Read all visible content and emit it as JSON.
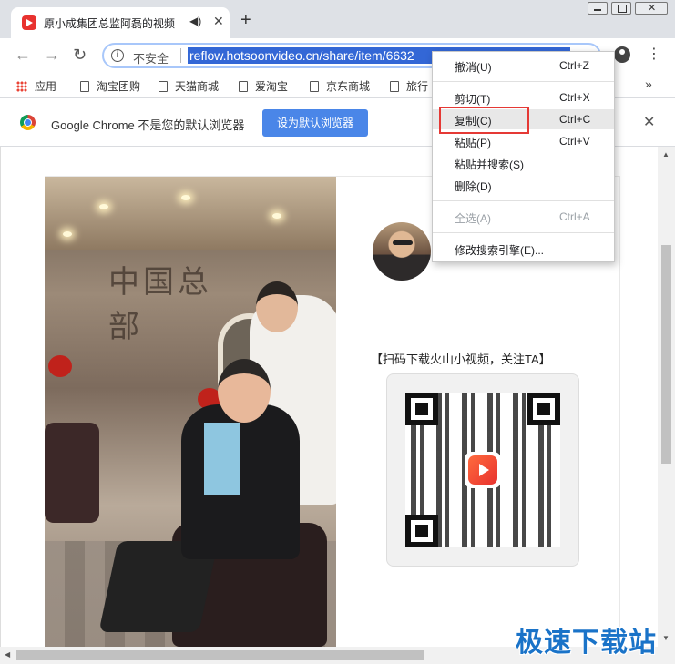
{
  "tab": {
    "title": "原小成集团总监阿磊的视频",
    "audio_icon": "speaker-icon",
    "close_glyph": "✕",
    "new_tab_glyph": "+"
  },
  "toolbar": {
    "security_label": "不安全",
    "url": "reflow.hotsoonvideo.cn/share/item/6632",
    "back_glyph": "←",
    "forward_glyph": "→",
    "reload_glyph": "↻",
    "menu_glyph": "⋮"
  },
  "bookmarks": {
    "items": [
      {
        "label": "应用",
        "icon": "apps-icon"
      },
      {
        "label": "淘宝团购",
        "icon": "page-icon"
      },
      {
        "label": "天猫商城",
        "icon": "page-icon"
      },
      {
        "label": "爱淘宝",
        "icon": "page-icon"
      },
      {
        "label": "京东商城",
        "icon": "page-icon"
      },
      {
        "label": "旅行",
        "icon": "page-icon"
      }
    ],
    "more_glyph": "»"
  },
  "infobar": {
    "message": "Google Chrome 不是您的默认浏览器",
    "button_label": "设为默认浏览器",
    "close_glyph": "✕"
  },
  "page": {
    "qr_caption": "【扫码下载火山小视频，关注TA】"
  },
  "context_menu": {
    "items": [
      {
        "label": "撤消(U)",
        "shortcut": "Ctrl+Z",
        "enabled": true
      },
      {
        "label": "剪切(T)",
        "shortcut": "Ctrl+X",
        "enabled": true
      },
      {
        "label": "复制(C)",
        "shortcut": "Ctrl+C",
        "enabled": true,
        "highlighted": true
      },
      {
        "label": "粘贴(P)",
        "shortcut": "Ctrl+V",
        "enabled": true
      },
      {
        "label": "粘贴并搜索(S)",
        "shortcut": "",
        "enabled": true
      },
      {
        "label": "删除(D)",
        "shortcut": "",
        "enabled": true
      },
      {
        "label": "全选(A)",
        "shortcut": "Ctrl+A",
        "enabled": false
      },
      {
        "label": "修改搜索引擎(E)...",
        "shortcut": "",
        "enabled": true
      }
    ]
  },
  "watermark": "极速下载站",
  "colors": {
    "accent_blue": "#4a86e8",
    "url_selection": "#3367d6",
    "highlight_box": "#e53935",
    "watermark": "#1a73c8"
  }
}
